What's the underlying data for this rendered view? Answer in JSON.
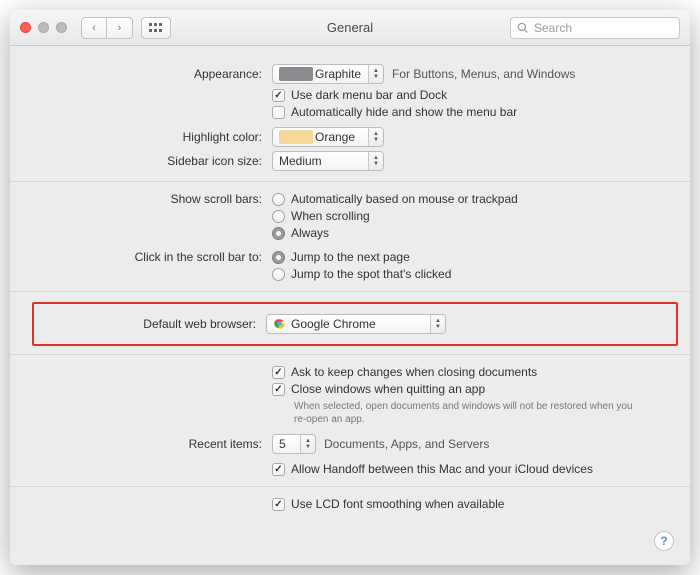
{
  "title": "General",
  "search_placeholder": "Search",
  "labels": {
    "appearance": "Appearance:",
    "highlight": "Highlight color:",
    "sidebar": "Sidebar icon size:",
    "scrollbars": "Show scroll bars:",
    "scrollclick": "Click in the scroll bar to:",
    "browser": "Default web browser:",
    "recent": "Recent items:"
  },
  "appearance": {
    "value": "Graphite",
    "hint": "For Buttons, Menus, and Windows",
    "darkmenu": "Use dark menu bar and Dock",
    "autohide": "Automatically hide and show the menu bar",
    "swatch": "#8a8a8f"
  },
  "highlight": {
    "value": "Orange",
    "swatch": "#f6d79a"
  },
  "sidebar": {
    "value": "Medium"
  },
  "scrollbars": {
    "opt1": "Automatically based on mouse or trackpad",
    "opt2": "When scrolling",
    "opt3": "Always"
  },
  "scrollclick": {
    "opt1": "Jump to the next page",
    "opt2": "Jump to the spot that's clicked"
  },
  "browser": {
    "value": "Google Chrome"
  },
  "docs": {
    "ask": "Ask to keep changes when closing documents",
    "close": "Close windows when quitting an app",
    "close_sub": "When selected, open documents and windows will not be restored when you re-open an app."
  },
  "recent": {
    "value": "5",
    "suffix": "Documents, Apps, and Servers"
  },
  "handoff": "Allow Handoff between this Mac and your iCloud devices",
  "lcd": "Use LCD font smoothing when available",
  "help": "?"
}
